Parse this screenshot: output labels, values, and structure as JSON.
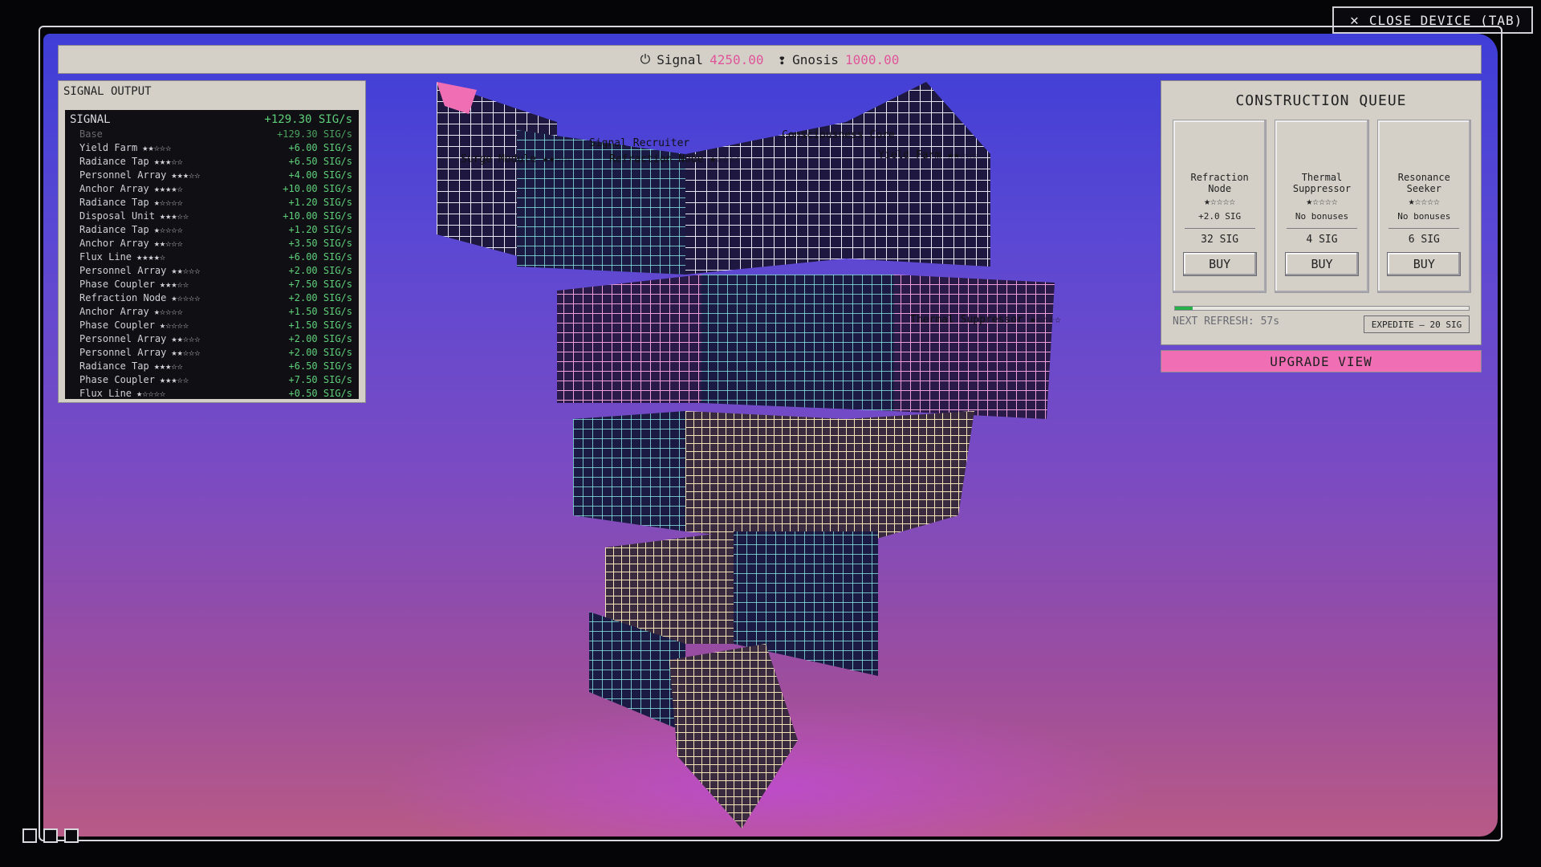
{
  "close_device_label": "CLOSE DEVICE (TAB)",
  "top_bar": {
    "signal_label": "Signal",
    "signal_value": "4250.00",
    "gnosis_label": "Gnosis",
    "gnosis_value": "1000.00"
  },
  "signal_output": {
    "title": "SIGNAL OUTPUT",
    "header_label": "SIGNAL",
    "header_rate": "+129.30 SIG/s",
    "base_label": "Base",
    "base_rate": "+129.30 SIG/s",
    "rows": [
      {
        "name": "Yield Farm",
        "stars": "★★☆☆☆",
        "rate": "+6.00 SIG/s"
      },
      {
        "name": "Radiance Tap",
        "stars": "★★★☆☆",
        "rate": "+6.50 SIG/s"
      },
      {
        "name": "Personnel Array",
        "stars": "★★★☆☆",
        "rate": "+4.00 SIG/s"
      },
      {
        "name": "Anchor Array",
        "stars": "★★★★☆",
        "rate": "+10.00 SIG/s"
      },
      {
        "name": "Radiance Tap",
        "stars": "★☆☆☆☆",
        "rate": "+1.20 SIG/s"
      },
      {
        "name": "Disposal Unit",
        "stars": "★★★☆☆",
        "rate": "+10.00 SIG/s"
      },
      {
        "name": "Radiance Tap",
        "stars": "★☆☆☆☆",
        "rate": "+1.20 SIG/s"
      },
      {
        "name": "Anchor Array",
        "stars": "★★☆☆☆",
        "rate": "+3.50 SIG/s"
      },
      {
        "name": "Flux Line",
        "stars": "★★★★☆",
        "rate": "+6.00 SIG/s"
      },
      {
        "name": "Personnel Array",
        "stars": "★★☆☆☆",
        "rate": "+2.00 SIG/s"
      },
      {
        "name": "Phase Coupler",
        "stars": "★★★☆☆",
        "rate": "+7.50 SIG/s"
      },
      {
        "name": "Refraction Node",
        "stars": "★☆☆☆☆",
        "rate": "+2.00 SIG/s"
      },
      {
        "name": "Anchor Array",
        "stars": "★☆☆☆☆",
        "rate": "+1.50 SIG/s"
      },
      {
        "name": "Phase Coupler",
        "stars": "★☆☆☆☆",
        "rate": "+1.50 SIG/s"
      },
      {
        "name": "Personnel Array",
        "stars": "★★☆☆☆",
        "rate": "+2.00 SIG/s"
      },
      {
        "name": "Personnel Array",
        "stars": "★★☆☆☆",
        "rate": "+2.00 SIG/s"
      },
      {
        "name": "Radiance Tap",
        "stars": "★★★☆☆",
        "rate": "+6.50 SIG/s"
      },
      {
        "name": "Phase Coupler",
        "stars": "★★★☆☆",
        "rate": "+7.50 SIG/s"
      },
      {
        "name": "Flux Line",
        "stars": "★☆☆☆☆",
        "rate": "+0.50 SIG/s"
      }
    ]
  },
  "construction_queue": {
    "title": "CONSTRUCTION QUEUE",
    "cards": [
      {
        "name_line1": "Refraction",
        "name_line2": "Node",
        "stars": "★☆☆☆☆",
        "bonus": "+2.0 SIG",
        "cost": "32 SIG",
        "buy_label": "BUY"
      },
      {
        "name_line1": "Thermal",
        "name_line2": "Suppressor",
        "stars": "★☆☆☆☆",
        "bonus": "No bonuses",
        "cost": "4 SIG",
        "buy_label": "BUY"
      },
      {
        "name_line1": "Resonance",
        "name_line2": "Seeker",
        "stars": "★☆☆☆☆",
        "bonus": "No bonuses",
        "cost": "6 SIG",
        "buy_label": "BUY"
      }
    ],
    "refresh_progress": 0.06,
    "next_refresh": "NEXT REFRESH: 57s",
    "expedite_label": "EXPEDITE — 20 SIG"
  },
  "upgrade_view_label": "UPGRADE VIEW",
  "scene_labels": {
    "surge_module": "Surge Module ★★☆☆☆",
    "refraction_node": "Refraction Node ★☆☆☆☆",
    "signal_recruiter": "Signal Recruiter",
    "consciousness_core": "Consciousness Core",
    "yield_farm": "Yield Farm ★★☆☆☆",
    "thermal_suppressor": "Thermal Suppressor ★☆☆☆☆"
  },
  "colors": {
    "signal_value": "#e0559a",
    "rate_green": "#5fd07a",
    "upgrade_pink": "#f06fb4",
    "panel_bg": "#d4d0c8",
    "progress_green": "#27b04a"
  }
}
